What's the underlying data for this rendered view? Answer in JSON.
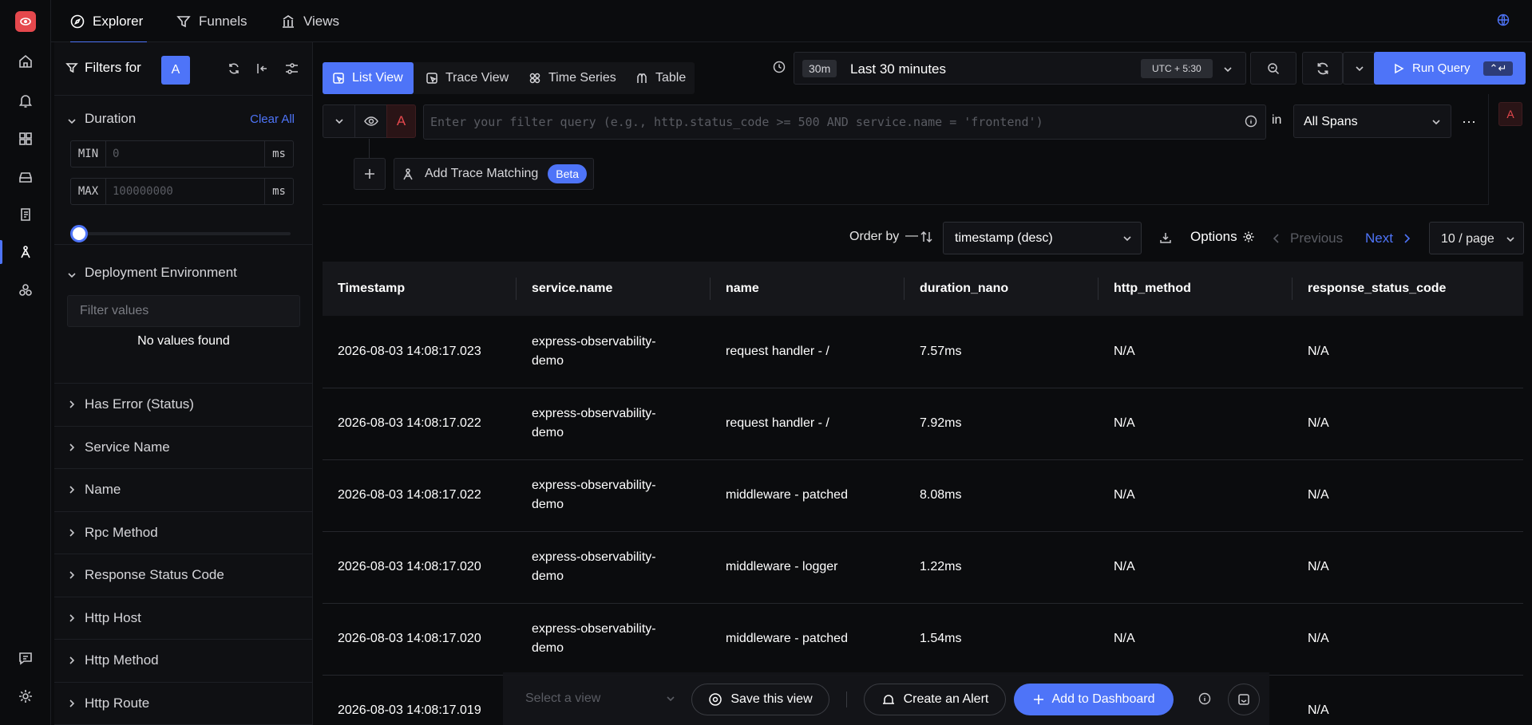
{
  "nav": {
    "tabs": [
      {
        "label": "Explorer",
        "icon": "compass-icon",
        "active": true
      },
      {
        "label": "Funnels",
        "icon": "funnel-icon"
      },
      {
        "label": "Views",
        "icon": "views-icon"
      }
    ],
    "globe_icon": "globe-icon"
  },
  "filters": {
    "title": "Filters for",
    "query_badge": "A",
    "duration": {
      "title": "Duration",
      "clear_label": "Clear All",
      "min_label": "MIN",
      "min_placeholder": "0",
      "max_label": "MAX",
      "max_placeholder": "100000000",
      "unit": "ms",
      "slider_fraction": 0
    },
    "deployment": {
      "title": "Deployment Environment",
      "search_placeholder": "Filter values",
      "empty_text": "No values found"
    },
    "collapsed_sections": [
      "Has Error (Status)",
      "Service Name",
      "Name",
      "Rpc Method",
      "Response Status Code",
      "Http Host",
      "Http Method",
      "Http Route"
    ]
  },
  "view_tabs": [
    "List View",
    "Trace View",
    "Time Series",
    "Table"
  ],
  "time": {
    "short": "30m",
    "label": "Last 30 minutes",
    "tz": "UTC + 5:30"
  },
  "run_query": {
    "label": "Run Query",
    "shortcut": "⌃↵"
  },
  "query": {
    "badge": "A",
    "placeholder": "Enter your filter query (e.g., http.status_code >= 500 AND service.name = 'frontend')",
    "in_label": "in",
    "source": "All Spans",
    "add_trace_label": "Add Trace Matching",
    "beta_label": "Beta",
    "side_badge": "A"
  },
  "results_toolbar": {
    "order_by_label": "Order by",
    "order_value": "timestamp (desc)",
    "options_label": "Options",
    "previous_label": "Previous",
    "next_label": "Next",
    "page_size": "10 / page"
  },
  "table": {
    "columns": [
      "Timestamp",
      "service.name",
      "name",
      "duration_nano",
      "http_method",
      "response_status_code"
    ],
    "rows": [
      [
        "2026-08-03 14:08:17.023",
        "express-observability-demo",
        "request handler - /",
        "7.57ms",
        "N/A",
        "N/A"
      ],
      [
        "2026-08-03 14:08:17.022",
        "express-observability-demo",
        "request handler - /",
        "7.92ms",
        "N/A",
        "N/A"
      ],
      [
        "2026-08-03 14:08:17.022",
        "express-observability-demo",
        "middleware - patched",
        "8.08ms",
        "N/A",
        "N/A"
      ],
      [
        "2026-08-03 14:08:17.020",
        "express-observability-demo",
        "middleware - logger",
        "1.22ms",
        "N/A",
        "N/A"
      ],
      [
        "2026-08-03 14:08:17.020",
        "express-observability-demo",
        "middleware - patched",
        "1.54ms",
        "N/A",
        "N/A"
      ],
      [
        "2026-08-03 14:08:17.019",
        "",
        "",
        "",
        "",
        "N/A"
      ]
    ]
  },
  "bottom_bar": {
    "select_placeholder": "Select a view",
    "save_label": "Save this view",
    "alert_label": "Create an Alert",
    "dashboard_label": "Add to Dashboard"
  },
  "colors": {
    "accent": "#4e74f8",
    "query_red": "#e5484d",
    "background": "#0b0c0e"
  }
}
